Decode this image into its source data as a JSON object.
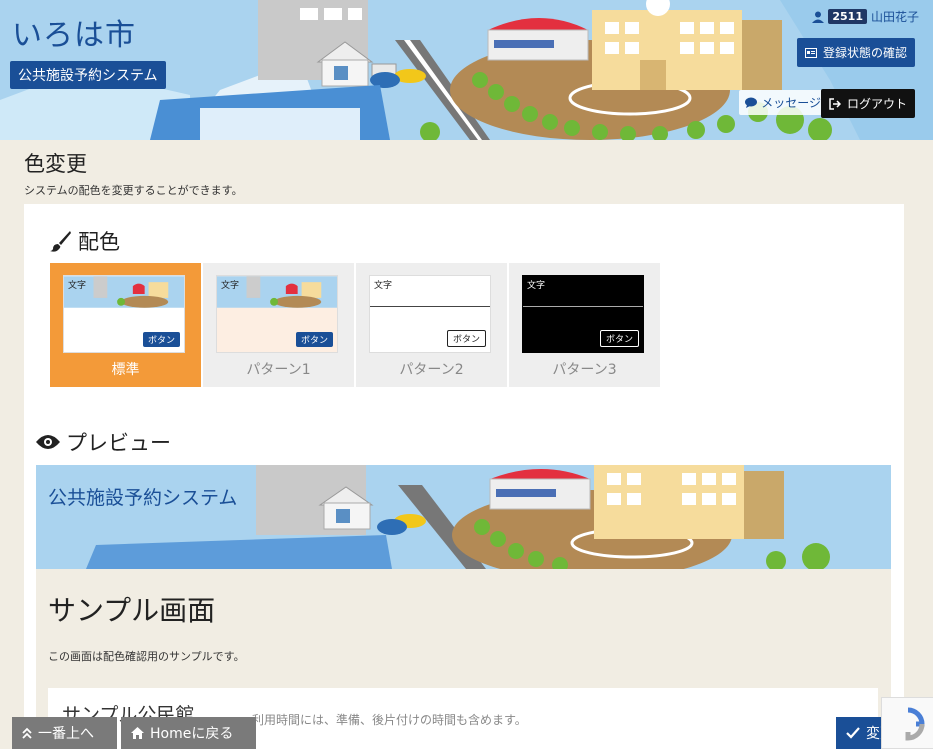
{
  "header": {
    "site_title": "いろは市",
    "system_name": "公共施設予約システム",
    "user_id": "2511",
    "user_name": "山田花子",
    "registration_button": "登録状態の確認",
    "message_button": "メッセージ",
    "logout_button": "ログアウト"
  },
  "page": {
    "title": "色変更",
    "description": "システムの配色を変更することができます。"
  },
  "color_section": {
    "heading": "配色",
    "options": [
      {
        "label": "標準",
        "selected": true,
        "thumb_text": "文字",
        "thumb_button": "ボタン"
      },
      {
        "label": "パターン1",
        "selected": false,
        "thumb_text": "文字",
        "thumb_button": "ボタン"
      },
      {
        "label": "パターン2",
        "selected": false,
        "thumb_text": "文字",
        "thumb_button": "ボタン"
      },
      {
        "label": "パターン3",
        "selected": false,
        "thumb_text": "文字",
        "thumb_button": "ボタン"
      }
    ]
  },
  "preview_section": {
    "heading": "プレビュー",
    "system_name": "公共施設予約システム",
    "sample_title": "サンプル画面",
    "sample_description": "この画面は配色確認用のサンプルです。",
    "facility_title": "サンプル公民館"
  },
  "footer": {
    "note": "利用時間には、準備、後片付けの時間も含めます。",
    "top_button": "一番上へ",
    "home_button": "Homeに戻る",
    "change_button": "変更"
  },
  "colors": {
    "primary": "#1a4f97",
    "accent_selected": "#f39a39",
    "page_background": "#f1ede3",
    "footer_button": "#7a7a7a",
    "dark": "#111111"
  }
}
